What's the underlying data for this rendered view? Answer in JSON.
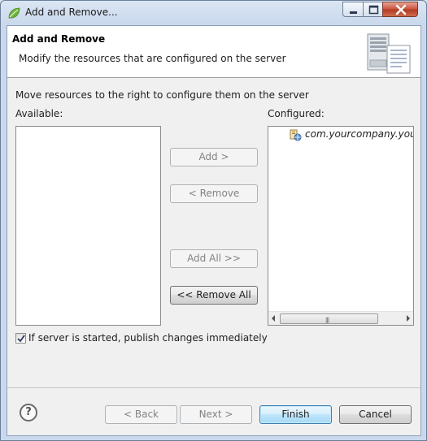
{
  "window": {
    "title": "Add and Remove...",
    "icon": "spring-leaf-icon"
  },
  "header": {
    "title": "Add and Remove",
    "description": "Modify the resources that are configured on the server",
    "icon": "server-icon"
  },
  "main": {
    "instruction": "Move resources to the right to configure them on the server",
    "available_label": "Available:",
    "configured_label": "Configured:",
    "available_items": [],
    "configured_items": [
      {
        "label": "com.yourcompany.yourp",
        "icon": "web-module-icon"
      }
    ],
    "buttons": {
      "add": "Add >",
      "remove": "< Remove",
      "add_all": "Add All >>",
      "remove_all": "<< Remove All"
    },
    "publish_checkbox": {
      "label": "If server is started, publish changes immediately",
      "checked": true
    }
  },
  "footer": {
    "help": "?",
    "back": "< Back",
    "next": "Next >",
    "finish": "Finish",
    "cancel": "Cancel"
  },
  "colors": {
    "title_gradient_top": "#dbe6f4",
    "dialog_bg": "#f0f0f0",
    "default_button_border": "#3c7fb1",
    "close_button": "#c8503a"
  }
}
